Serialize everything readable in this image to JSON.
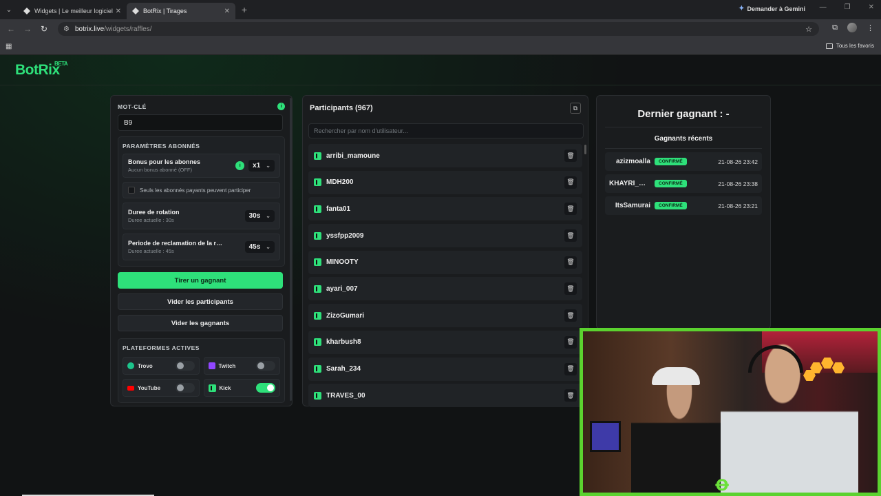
{
  "browser": {
    "tabs": [
      {
        "title": "Widgets | Le meilleur logiciel p…",
        "active": false
      },
      {
        "title": "BotRix | Tirages",
        "active": true
      }
    ],
    "gemini_label": "Demander à Gemini",
    "url_host": "botrix.live",
    "url_path": "/widgets/raffles/",
    "bookmarks_label": "Tous les favoris"
  },
  "app": {
    "logo": "BotRix",
    "logo_badge": "BETA",
    "accent_color": "#2ee07a"
  },
  "left": {
    "keyword_title": "MOT-CLÉ",
    "keyword_value": "B9",
    "subs_title": "PARAMÈTRES ABONNÉS",
    "bonus_title": "Bonus pour les abonnes",
    "bonus_sub": "Aucun bonus abonné (OFF)",
    "bonus_value": "x1",
    "subs_only_label": "Seuls les abonnés payants peuvent participer",
    "rotation_title": "Duree de rotation",
    "rotation_sub": "Duree actuelle : 30s",
    "rotation_value": "30s",
    "claim_title": "Periode de reclamation de la r…",
    "claim_sub": "Duree actuelle : 45s",
    "claim_value": "45s",
    "draw_button": "Tirer un gagnant",
    "clear_participants": "Vider les participants",
    "clear_winners": "Vider les gagnants",
    "platforms_title": "PLATEFORMES ACTIVES",
    "platforms": [
      {
        "name": "Trovo",
        "enabled": false,
        "color": "#1cc48b"
      },
      {
        "name": "Twitch",
        "enabled": false,
        "color": "#9146ff"
      },
      {
        "name": "YouTube",
        "enabled": false,
        "color": "#ff0000"
      },
      {
        "name": "Kick",
        "enabled": true,
        "color": "#2ee07a"
      }
    ]
  },
  "participants": {
    "title": "Participants (967)",
    "search_placeholder": "Rechercher par nom d'utilisateur...",
    "items": [
      "arribi_mamoune",
      "MDH200",
      "fanta01",
      "yssfpp2009",
      "MINOOTY",
      "ayari_007",
      "ZizoGumari",
      "kharbush8",
      "Sarah_234",
      "TRAVES_00"
    ]
  },
  "winners": {
    "last_winner": "Dernier gagnant : -",
    "recent_title": "Gagnants récents",
    "items": [
      {
        "name": "azizmoalla",
        "status": "CONFIRMÉ",
        "time": "21-08-26 23:42"
      },
      {
        "name": "KHAYRI_GO…",
        "status": "CONFIRMÉ",
        "time": "21-08-26 23:38"
      },
      {
        "name": "ItsSamurai",
        "status": "CONFIRMÉ",
        "time": "21-08-26 23:21"
      }
    ]
  }
}
